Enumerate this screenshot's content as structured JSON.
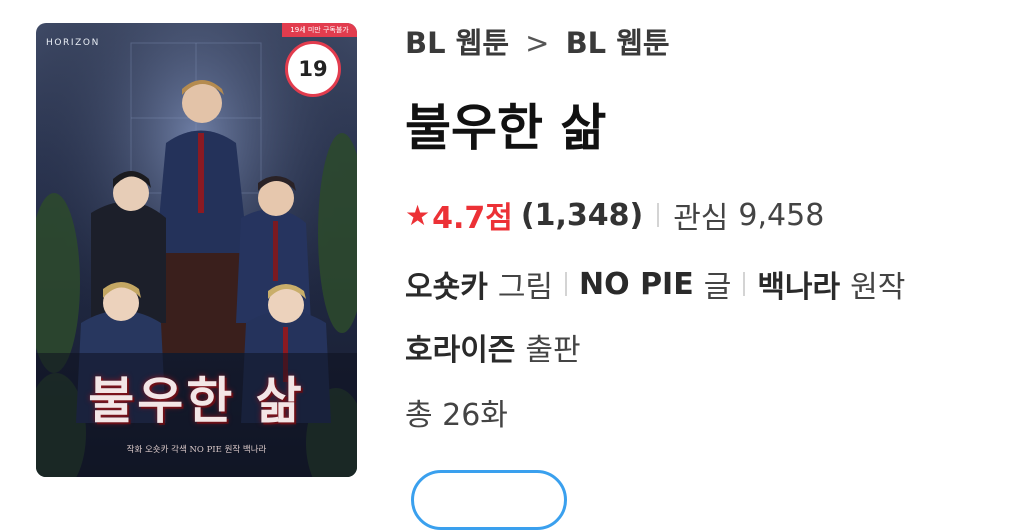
{
  "cover": {
    "brand": "HORIZON",
    "age_notice": "19세 미만 구독불가",
    "age_badge": "19",
    "title_art": "불우한 삶",
    "credit": "작화 오숏카 각색 NO PIE 원작 백나라"
  },
  "breadcrumb": {
    "items": [
      "BL 웹툰",
      "BL 웹툰"
    ],
    "separator": ">"
  },
  "title": "불우한 삶",
  "rating": {
    "score": "4.7점",
    "count": "(1,348)",
    "interest_label": "관심",
    "interest_value": "9,458"
  },
  "credits": {
    "artist_name": "오숏카",
    "artist_role": "그림",
    "writer_name": "NO PIE",
    "writer_role": "글",
    "original_name": "백나라",
    "original_role": "원작",
    "publisher_name": "호라이즌",
    "publisher_role": "출판"
  },
  "episodes": "총 26화",
  "colors": {
    "accent_red": "#ec3136",
    "badge_red": "#e23c4e",
    "button_blue": "#3aa0ee"
  },
  "icons": [
    "star-icon"
  ]
}
